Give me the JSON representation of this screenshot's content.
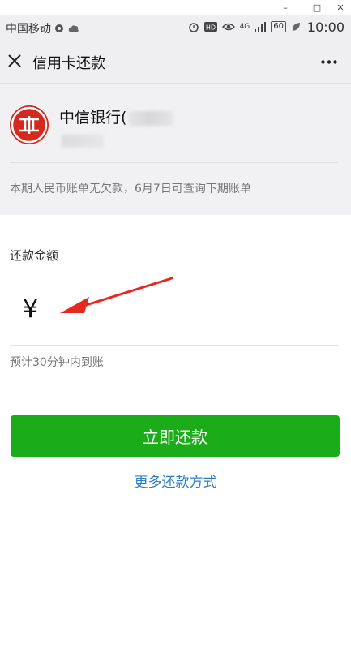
{
  "window": {
    "minimize": "–",
    "maximize": "□",
    "close": "✕"
  },
  "status_bar": {
    "carrier": "中国移动",
    "network": "4G",
    "battery": "60",
    "time": "10:00"
  },
  "header": {
    "title": "信用卡还款"
  },
  "bank": {
    "name": "中信银行(",
    "bill_tip": "本期人民币账单无欠款，6月7日可查询下期账单"
  },
  "payment": {
    "amount_label": "还款金额",
    "currency_symbol": "¥",
    "amount_value": "",
    "eta": "预计30分钟内到账"
  },
  "actions": {
    "pay_now": "立即还款",
    "more_methods": "更多还款方式"
  },
  "colors": {
    "primary_green": "#1aad19",
    "link_blue": "#2c7fc4",
    "bank_red": "#d7281f",
    "annotation_red": "#e8271f"
  }
}
